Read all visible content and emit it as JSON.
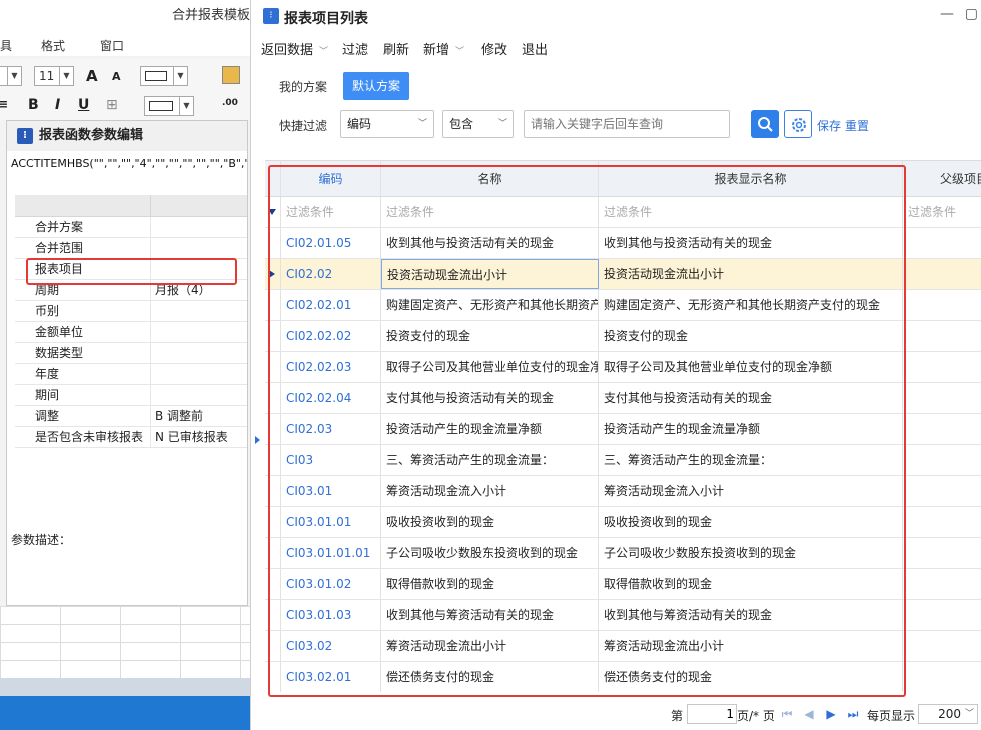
{
  "background_app": {
    "title": "合并报表模板/",
    "menu": [
      "具",
      "格式",
      "窗口"
    ],
    "font_size": "11",
    "font_grow": "A",
    "font_shrink": "A",
    "bold": "B",
    "italic": "I",
    "underline": "U",
    "param_editor": {
      "title": "报表函数参数编辑",
      "formula": "ACCTITEMHBS(\"\",\"\",\"\",\"4\",\"\",\"\",\"\",\"\",\"\",\"B\",\"N\")",
      "params": [
        {
          "name": "合并方案",
          "value": ""
        },
        {
          "name": "合并范围",
          "value": ""
        },
        {
          "name": "报表项目",
          "value": ""
        },
        {
          "name": "周期",
          "value": "月报（4）"
        },
        {
          "name": "币别",
          "value": ""
        },
        {
          "name": "金额单位",
          "value": ""
        },
        {
          "name": "数据类型",
          "value": ""
        },
        {
          "name": "年度",
          "value": ""
        },
        {
          "name": "期间",
          "value": ""
        },
        {
          "name": "调整",
          "value": "B  调整前"
        },
        {
          "name": "是否包含未审核报表",
          "value": "N  已审核报表"
        }
      ],
      "description_label": "参数描述："
    }
  },
  "dialog": {
    "title": "报表项目列表",
    "menu": [
      {
        "label": "返回数据",
        "has_dropdown": true
      },
      {
        "label": "过滤",
        "has_dropdown": false
      },
      {
        "label": "刷新",
        "has_dropdown": false
      },
      {
        "label": "新增",
        "has_dropdown": true
      },
      {
        "label": "修改",
        "has_dropdown": false
      },
      {
        "label": "退出",
        "has_dropdown": false
      }
    ],
    "schemes": {
      "mine": "我的方案",
      "default": "默认方案"
    },
    "quick_filter": {
      "label": "快捷过滤",
      "field": "编码",
      "operator": "包含",
      "placeholder": "请输入关键字后回车查询",
      "save": "保存",
      "reset": "重置"
    },
    "table": {
      "columns": [
        "编码",
        "名称",
        "报表显示名称",
        "父级项目"
      ],
      "filter_placeholder": "过滤条件",
      "selected_row": 1,
      "rows": [
        {
          "code": "CI02.01.05",
          "name": "收到其他与投资活动有关的现金",
          "display": "收到其他与投资活动有关的现金"
        },
        {
          "code": "CI02.02",
          "name": "投资活动现金流出小计",
          "display": "投资活动现金流出小计"
        },
        {
          "code": "CI02.02.01",
          "name": "购建固定资产、无形资产和其他长期资产支付的现金",
          "display": "购建固定资产、无形资产和其他长期资产支付的现金"
        },
        {
          "code": "CI02.02.02",
          "name": "投资支付的现金",
          "display": "投资支付的现金"
        },
        {
          "code": "CI02.02.03",
          "name": "取得子公司及其他营业单位支付的现金净额",
          "display": "取得子公司及其他营业单位支付的现金净额"
        },
        {
          "code": "CI02.02.04",
          "name": "支付其他与投资活动有关的现金",
          "display": "支付其他与投资活动有关的现金"
        },
        {
          "code": "CI02.03",
          "name": "投资活动产生的现金流量净额",
          "display": "投资活动产生的现金流量净额"
        },
        {
          "code": "CI03",
          "name": "三、筹资活动产生的现金流量：",
          "display": "三、筹资活动产生的现金流量："
        },
        {
          "code": "CI03.01",
          "name": "筹资活动现金流入小计",
          "display": "筹资活动现金流入小计"
        },
        {
          "code": "CI03.01.01",
          "name": "吸收投资收到的现金",
          "display": "吸收投资收到的现金"
        },
        {
          "code": "CI03.01.01.01",
          "name": "子公司吸收少数股东投资收到的现金",
          "display": "子公司吸收少数股东投资收到的现金"
        },
        {
          "code": "CI03.01.02",
          "name": "取得借款收到的现金",
          "display": "取得借款收到的现金"
        },
        {
          "code": "CI03.01.03",
          "name": "收到其他与筹资活动有关的现金",
          "display": "收到其他与筹资活动有关的现金"
        },
        {
          "code": "CI03.02",
          "name": "筹资活动现金流出小计",
          "display": "筹资活动现金流出小计"
        },
        {
          "code": "CI03.02.01",
          "name": "偿还债务支付的现金",
          "display": "偿还债务支付的现金"
        }
      ]
    },
    "pager": {
      "prefix": "第",
      "page": "1",
      "suffix": "页/* 页",
      "per_page_label": "每页显示",
      "per_page": "200"
    }
  },
  "colors": {
    "accent": "#3d8df5",
    "link": "#2f6fd6",
    "highlight": "#e53935",
    "selected_row": "#fdf3d6"
  }
}
